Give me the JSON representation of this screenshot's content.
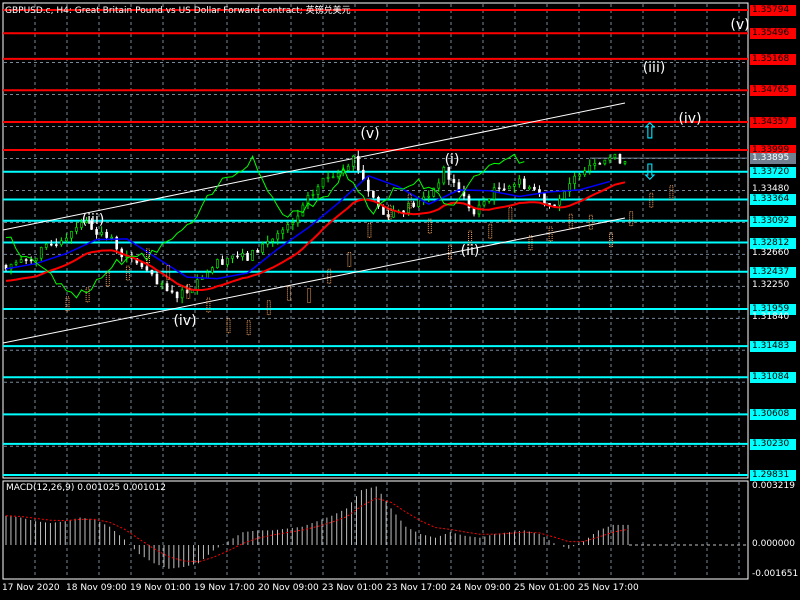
{
  "header": {
    "title": "GBPUSD.c, H4:  Great Britain Pound vs US Dollar Forward contract; 英镑兑美元"
  },
  "macd": {
    "title": "MACD(12,26,9) 0.001025 0.001012",
    "scale": [
      "0.003219",
      "0.000000",
      "-0.001651"
    ]
  },
  "colors": {
    "red_level": "#ff0000",
    "cyan_level": "#00ffff",
    "bull": "#00ff00",
    "ma": "#ff0000",
    "kijun": "#0000ff",
    "cloud": "#f4a460"
  },
  "chart_data": {
    "type": "candlestick",
    "symbol": "GBPUSD.c",
    "timeframe": "H4",
    "ylim": [
      1.2976,
      1.3587
    ],
    "closes": [
      1.3252,
      1.3256,
      1.3265,
      1.3278,
      1.3291,
      1.331,
      1.3297,
      1.3284,
      1.3259,
      1.3252,
      1.3227,
      1.3214,
      1.322,
      1.324,
      1.3256,
      1.3265,
      1.3261,
      1.3278,
      1.3291,
      1.3304,
      1.3336,
      1.3361,
      1.3374,
      1.339,
      1.3349,
      1.3317,
      1.3323,
      1.333,
      1.3342,
      1.3372,
      1.3349,
      1.3317,
      1.3342,
      1.3355,
      1.3359,
      1.3349,
      1.333,
      1.3342,
      1.3374,
      1.3387,
      1.339,
      1.3387
    ],
    "red_levels": [
      "1.35794",
      "1.35496",
      "1.35168",
      "1.34765",
      "1.34357",
      "1.33999"
    ],
    "cyan_levels": [
      "1.33720",
      "1.33364",
      "1.33092",
      "1.32812",
      "1.32437",
      "1.31959",
      "1.31483",
      "1.31084",
      "1.30608",
      "1.30230",
      "1.29831"
    ],
    "current_price": "1.33895",
    "grid_prices": [
      "1.33480",
      "1.32660",
      "1.32250",
      "1.31840"
    ],
    "x_labels": [
      "17 Nov 2020",
      "18 Nov 09:00",
      "19 Nov 01:00",
      "19 Nov 17:00",
      "20 Nov 09:00",
      "23 Nov 01:00",
      "23 Nov 17:00",
      "24 Nov 09:00",
      "25 Nov 01:00",
      "25 Nov 17:00"
    ],
    "wave_labels": [
      {
        "text": "(iii)",
        "price": 1.331
      },
      {
        "text": "(iv)",
        "price": 1.318
      },
      {
        "text": "(v)",
        "price": 1.342
      },
      {
        "text": "(i)",
        "price": 1.3387
      },
      {
        "text": "(ii)",
        "price": 1.327
      },
      {
        "text": "(iii)",
        "price": 1.3505
      },
      {
        "text": "(iv)",
        "price": 1.344
      },
      {
        "text": "(v)",
        "price": 1.356
      }
    ],
    "macd_hist": [
      0.0016,
      0.0015,
      0.0013,
      0.0012,
      0.0013,
      0.0015,
      0.0014,
      0.001,
      0.0003,
      -0.0005,
      -0.001,
      -0.0013,
      -0.0012,
      -0.001,
      -0.0003,
      0.0002,
      0.0007,
      0.0008,
      0.0008,
      0.0009,
      0.001,
      0.0013,
      0.0016,
      0.002,
      0.003,
      0.0032,
      0.002,
      0.001,
      0.0006,
      0.0004,
      0.0007,
      0.0005,
      0.0004,
      0.0006,
      0.0007,
      0.0008,
      0.0006,
      0.0001,
      -0.0002,
      0.0002,
      0.0008,
      0.0011,
      0.0011
    ],
    "macd_ylim": [
      -0.001651,
      0.003219
    ]
  }
}
